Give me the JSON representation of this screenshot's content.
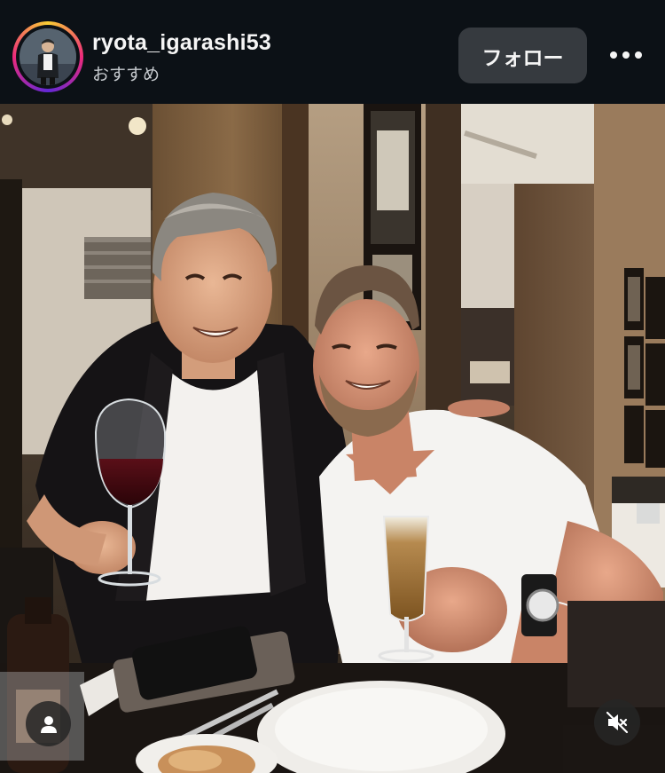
{
  "post_header": {
    "username": "ryota_igarashi53",
    "subtitle": "おすすめ",
    "follow_label": "フォロー",
    "avatar_icon": "profile-avatar",
    "more_icon": "more-horizontal-icon"
  },
  "photo": {
    "description_icon": "photo",
    "user_tag_icon": "user-tag-icon",
    "mute_icon": "speaker-muted-icon"
  },
  "colors": {
    "header_bg": "#0c1116",
    "follow_button_bg": "#363a3f",
    "text_primary": "#f5f5f5",
    "text_secondary": "#c8ccd0"
  }
}
